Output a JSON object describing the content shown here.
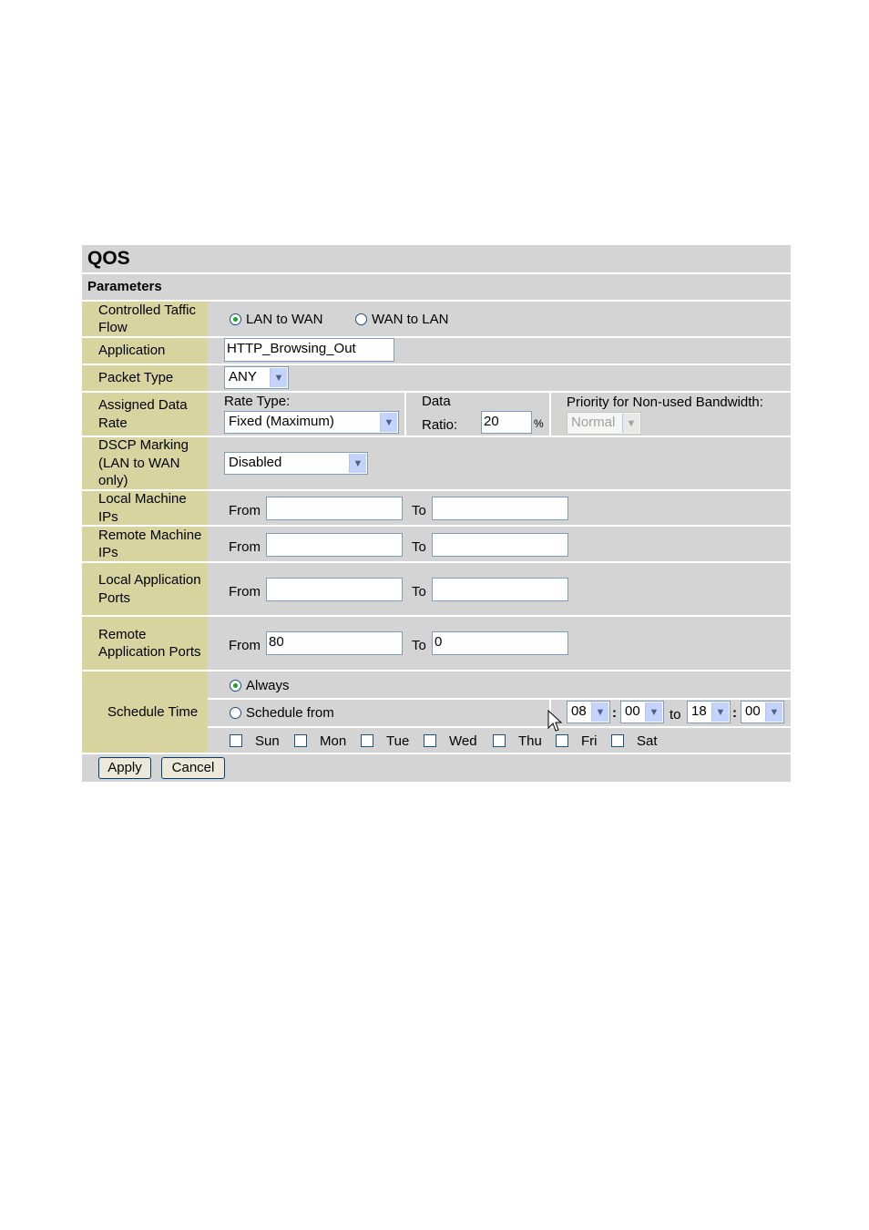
{
  "panel": {
    "title": "QOS",
    "subtitle": "Parameters"
  },
  "fields": {
    "traffic_flow": {
      "label": "Controlled Taffic Flow",
      "options": [
        "LAN to WAN",
        "WAN to LAN"
      ],
      "selected": "LAN to WAN"
    },
    "application": {
      "label": "Application",
      "value": "HTTP_Browsing_Out"
    },
    "packet_type": {
      "label": "Packet Type",
      "value": "ANY"
    },
    "data_rate": {
      "label": "Assigned Data Rate",
      "rate_type_label": "Rate Type:",
      "rate_type_value": "Fixed (Maximum)",
      "data_label": "Data",
      "ratio_label": "Ratio:",
      "ratio_value": "20",
      "percent": "%",
      "priority_label": "Priority for Non-used Bandwidth:",
      "priority_value": "Normal"
    },
    "dscp": {
      "label": "DSCP Marking (LAN to WAN only)",
      "value": "Disabled"
    },
    "local_ips": {
      "label": "Local Machine IPs",
      "from_label": "From",
      "from_value": "",
      "to_label": "To",
      "to_value": ""
    },
    "remote_ips": {
      "label": "Remote Machine IPs",
      "from_label": "From",
      "from_value": "",
      "to_label": "To",
      "to_value": ""
    },
    "local_ports": {
      "label": "Local Application Ports",
      "from_label": "From",
      "from_value": "",
      "to_label": "To",
      "to_value": ""
    },
    "remote_ports": {
      "label": "Remote Application Ports",
      "from_label": "From",
      "from_value": "80",
      "to_label": "To",
      "to_value": "0"
    },
    "schedule": {
      "label": "Schedule Time",
      "always_label": "Always",
      "schedule_from_label": "Schedule from",
      "selected": "Always",
      "start_hour": "08",
      "start_min": "00",
      "colon": ":",
      "to_label": "to",
      "end_hour": "18",
      "end_min": "00",
      "days": [
        "Sun",
        "Mon",
        "Tue",
        "Wed",
        "Thu",
        "Fri",
        "Sat"
      ]
    }
  },
  "buttons": {
    "apply": "Apply",
    "cancel": "Cancel"
  },
  "icons": {
    "radio": "radio-button",
    "dropdown": "chevron-down-icon",
    "cursor": "mouse-pointer-icon"
  },
  "colors": {
    "panel_bg": "#d4d4d4",
    "label_bg": "#d8d4a0",
    "separator": "#ffffff"
  }
}
